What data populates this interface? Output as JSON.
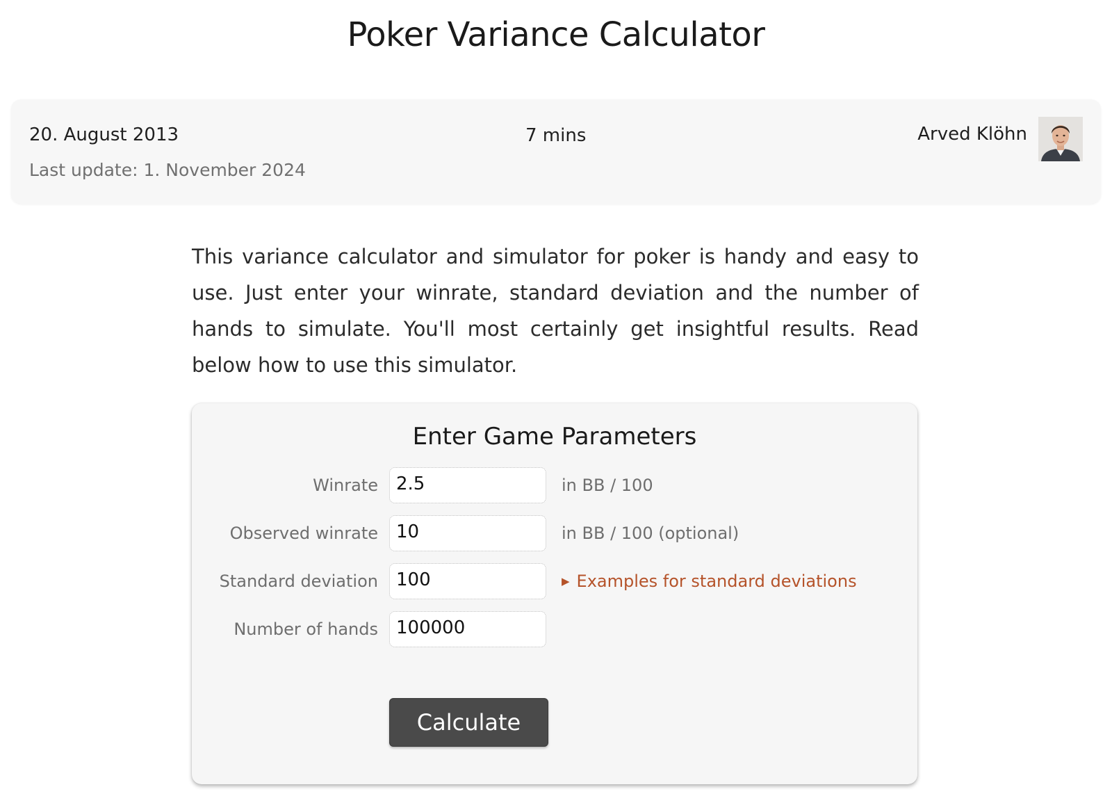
{
  "page": {
    "title": "Poker Variance Calculator"
  },
  "meta": {
    "date": "20. August 2013",
    "last_update": "Last update: 1. November 2024",
    "reading_time": "7 mins",
    "author": "Arved Klöhn"
  },
  "intro": {
    "text": "This variance calculator and simulator for poker is handy and easy to use. Just enter your winrate, standard deviation and the number of hands to simulate. You'll most certainly get insightful results. Read below how to use this simulator."
  },
  "form": {
    "title": "Enter Game Parameters",
    "fields": [
      {
        "label": "Winrate",
        "value": "2.5",
        "hint": "in BB / 100"
      },
      {
        "label": "Observed winrate",
        "value": "10",
        "hint": "in BB / 100 (optional)"
      },
      {
        "label": "Standard deviation",
        "value": "100",
        "link": "Examples for standard deviations"
      },
      {
        "label": "Number of hands",
        "value": "100000"
      }
    ],
    "submit_label": "Calculate"
  },
  "colors": {
    "link": "#b5532a",
    "button_bg": "#4a4a4a",
    "card_bg": "#f6f6f6"
  },
  "icons": {
    "link_marker": "▶",
    "author_avatar": "author-portrait"
  }
}
